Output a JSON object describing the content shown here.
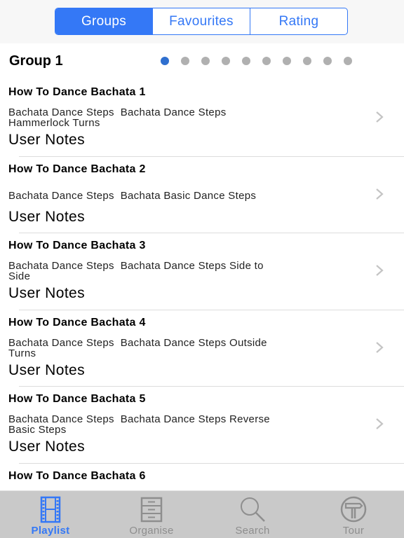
{
  "segmented": {
    "items": [
      {
        "label": "Groups",
        "active": true
      },
      {
        "label": "Favourites",
        "active": false
      },
      {
        "label": "Rating",
        "active": false
      }
    ]
  },
  "group": {
    "title": "Group 1",
    "page_count": 10,
    "current_page": 1
  },
  "list": {
    "items": [
      {
        "title": "How To Dance Bachata 1",
        "description": "Bachata Dance Steps  Bachata Dance Steps\nHammerlock Turns",
        "notes": "User Notes"
      },
      {
        "title": "How To Dance Bachata 2",
        "description": "Bachata Dance Steps  Bachata Basic Dance Steps",
        "notes": "User Notes"
      },
      {
        "title": "How To Dance Bachata 3",
        "description": "Bachata Dance Steps  Bachata Dance Steps Side to\nSide",
        "notes": "User Notes"
      },
      {
        "title": "How To Dance Bachata 4",
        "description": "Bachata Dance Steps  Bachata Dance Steps Outside\nTurns",
        "notes": "User Notes"
      },
      {
        "title": "How To Dance Bachata 5",
        "description": "Bachata Dance Steps  Bachata Dance Steps Reverse\nBasic Steps",
        "notes": "User Notes"
      },
      {
        "title": "How To Dance Bachata 6",
        "description": "",
        "notes": ""
      }
    ]
  },
  "tabbar": {
    "items": [
      {
        "label": "Playlist",
        "icon": "film-strip-icon",
        "active": true
      },
      {
        "label": "Organise",
        "icon": "filing-cabinet-icon",
        "active": false
      },
      {
        "label": "Search",
        "icon": "magnifier-icon",
        "active": false
      },
      {
        "label": "Tour",
        "icon": "signpost-icon",
        "active": false
      }
    ]
  },
  "colors": {
    "accent": "#3478f6",
    "active_dot": "#2f6fcf",
    "inactive_dot": "#b0b0b0",
    "tabbar_bg": "#c9c9c9",
    "inactive_tab": "#8e8e8e"
  }
}
